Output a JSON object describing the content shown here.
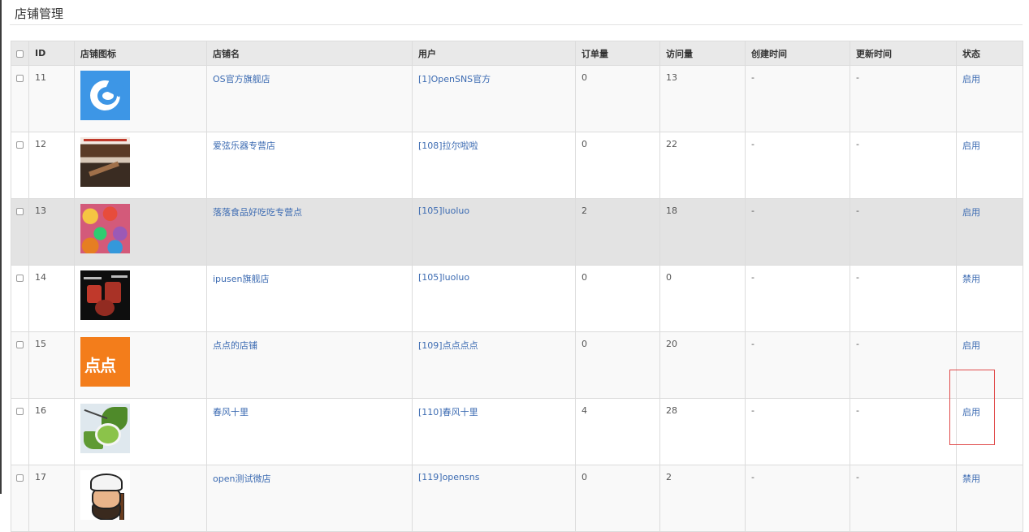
{
  "page": {
    "title": "店铺管理"
  },
  "table": {
    "headers": {
      "id": "ID",
      "icon": "店铺图标",
      "name": "店铺名",
      "user": "用户",
      "orders": "订单量",
      "visits": "访问量",
      "created": "创建时间",
      "updated": "更新时间",
      "status": "状态"
    },
    "rows": [
      {
        "id": "11",
        "icon": "blue-swirl-logo",
        "name": "OS官方旗舰店",
        "user": "[1]OpenSNS官方",
        "orders": "0",
        "visits": "13",
        "created": "-",
        "updated": "-",
        "status": "启用"
      },
      {
        "id": "12",
        "icon": "music-store-photo",
        "name": "爱弦乐器专营店",
        "user": "[108]拉尔啦啦",
        "orders": "0",
        "visits": "22",
        "created": "-",
        "updated": "-",
        "status": "启用"
      },
      {
        "id": "13",
        "icon": "candy-photo",
        "name": "落落食品好吃吃专营点",
        "user": "[105]luoluo",
        "orders": "2",
        "visits": "18",
        "created": "-",
        "updated": "-",
        "status": "启用"
      },
      {
        "id": "14",
        "icon": "drum-kit-photo",
        "name": "ipusen旗舰店",
        "user": "[105]luoluo",
        "orders": "0",
        "visits": "0",
        "created": "-",
        "updated": "-",
        "status": "禁用"
      },
      {
        "id": "15",
        "icon": "orange-dian-logo",
        "name": "点点的店铺",
        "user": "[109]点点点点",
        "orders": "0",
        "visits": "20",
        "created": "-",
        "updated": "-",
        "status": "启用"
      },
      {
        "id": "16",
        "icon": "green-tea-photo",
        "name": "春风十里",
        "user": "[110]春风十里",
        "orders": "4",
        "visits": "28",
        "created": "-",
        "updated": "-",
        "status": "启用"
      },
      {
        "id": "17",
        "icon": "cartoon-man-avatar",
        "name": "open测试微店",
        "user": "[119]opensns",
        "orders": "0",
        "visits": "2",
        "created": "-",
        "updated": "-",
        "status": "禁用"
      }
    ],
    "thumb_labels": {
      "orange": "点点"
    }
  },
  "colors": {
    "link": "#3c6bb2",
    "header_bg": "#e9e9e9",
    "hover_row": "#e3e3e3",
    "highlight": "#e04a4a"
  }
}
